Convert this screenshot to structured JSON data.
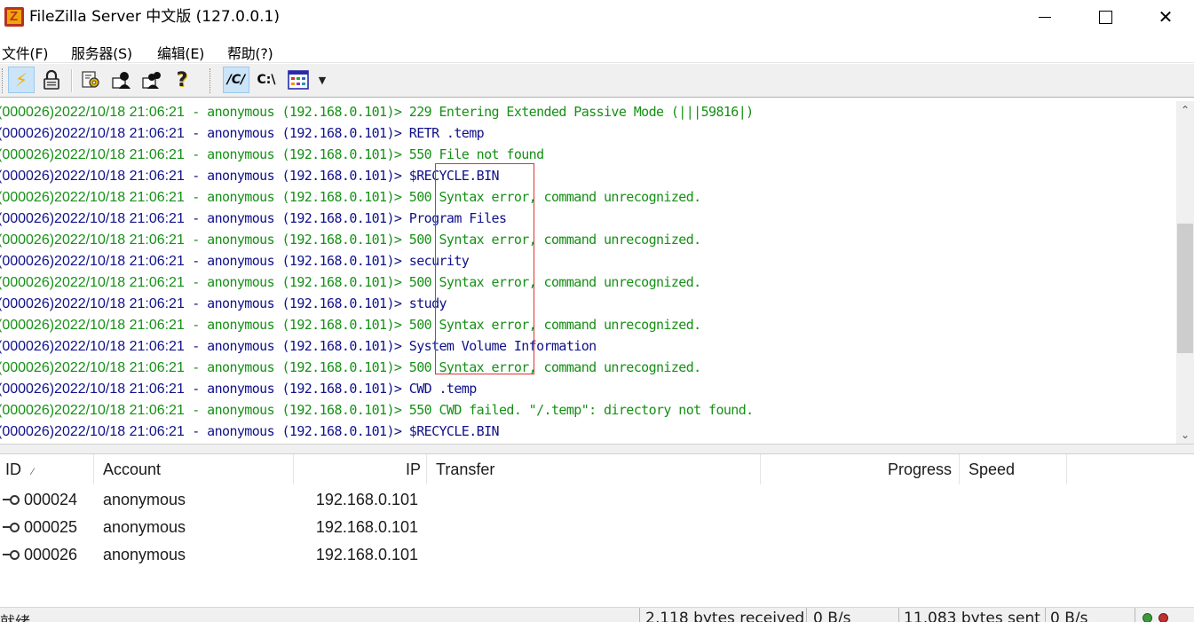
{
  "window": {
    "title": "FileZilla Server 中文版 (127.0.0.1)",
    "app_icon_letter": "Z",
    "minimize_label": "",
    "maximize_label": "",
    "close_label": "✕"
  },
  "menu": [
    {
      "label": "文件(F)"
    },
    {
      "label": "服务器(S)"
    },
    {
      "label": "编辑(E)"
    },
    {
      "label": "帮助(?)"
    }
  ],
  "toolbar": {
    "connect_glyph": "⚡",
    "lock_glyph": "🔒",
    "help_glyph": "?",
    "path_unix_label": "/C/",
    "path_win_label": "C:\\",
    "dropdown_glyph": "▼"
  },
  "log": {
    "lines": [
      {
        "type": "resp",
        "prefix": "(000026)",
        "ts": "2022/10/18 21:06:21",
        "text": " - anonymous (192.168.0.101)> 229 Entering Extended Passive Mode (|||59816|)"
      },
      {
        "type": "cmd",
        "prefix": "(000026)",
        "ts": "2022/10/18 21:06:21",
        "text": " - anonymous (192.168.0.101)> RETR .temp"
      },
      {
        "type": "resp",
        "prefix": "(000026)",
        "ts": "2022/10/18 21:06:21",
        "text": " - anonymous (192.168.0.101)> 550 File not found"
      },
      {
        "type": "cmd",
        "prefix": "(000026)",
        "ts": "2022/10/18 21:06:21",
        "text": " - anonymous (192.168.0.101)> $RECYCLE.BIN"
      },
      {
        "type": "resp",
        "prefix": "(000026)",
        "ts": "2022/10/18 21:06:21",
        "text": " - anonymous (192.168.0.101)> 500 Syntax error, command unrecognized."
      },
      {
        "type": "cmd",
        "prefix": "(000026)",
        "ts": "2022/10/18 21:06:21",
        "text": " - anonymous (192.168.0.101)> Program Files"
      },
      {
        "type": "resp",
        "prefix": "(000026)",
        "ts": "2022/10/18 21:06:21",
        "text": " - anonymous (192.168.0.101)> 500 Syntax error, command unrecognized."
      },
      {
        "type": "cmd",
        "prefix": "(000026)",
        "ts": "2022/10/18 21:06:21",
        "text": " - anonymous (192.168.0.101)> security"
      },
      {
        "type": "resp",
        "prefix": "(000026)",
        "ts": "2022/10/18 21:06:21",
        "text": " - anonymous (192.168.0.101)> 500 Syntax error, command unrecognized."
      },
      {
        "type": "cmd",
        "prefix": "(000026)",
        "ts": "2022/10/18 21:06:21",
        "text": " - anonymous (192.168.0.101)> study"
      },
      {
        "type": "resp",
        "prefix": "(000026)",
        "ts": "2022/10/18 21:06:21",
        "text": " - anonymous (192.168.0.101)> 500 Syntax error, command unrecognized."
      },
      {
        "type": "cmd",
        "prefix": "(000026)",
        "ts": "2022/10/18 21:06:21",
        "text": " - anonymous (192.168.0.101)> System Volume Information"
      },
      {
        "type": "resp",
        "prefix": "(000026)",
        "ts": "2022/10/18 21:06:21",
        "text": " - anonymous (192.168.0.101)> 500 Syntax error, command unrecognized."
      },
      {
        "type": "cmd",
        "prefix": "(000026)",
        "ts": "2022/10/18 21:06:21",
        "text": " - anonymous (192.168.0.101)> CWD .temp"
      },
      {
        "type": "resp",
        "prefix": "(000026)",
        "ts": "2022/10/18 21:06:21",
        "text": " - anonymous (192.168.0.101)> 550 CWD failed. \"/.temp\": directory not found."
      },
      {
        "type": "cmd",
        "prefix": "(000026)",
        "ts": "2022/10/18 21:06:21",
        "text": " - anonymous (192.168.0.101)> $RECYCLE.BIN"
      }
    ],
    "command_color": "#10108a",
    "response_color": "#159015"
  },
  "scrollbar": {
    "up_glyph": "⌃",
    "down_glyph": "⌄"
  },
  "sessions": {
    "columns": {
      "id": "ID",
      "id_sort": "⁄",
      "account": "Account",
      "ip": "IP",
      "transfer": "Transfer",
      "progress": "Progress",
      "speed": "Speed"
    },
    "rows": [
      {
        "id": "000024",
        "account": "anonymous",
        "ip": "192.168.0.101"
      },
      {
        "id": "000025",
        "account": "anonymous",
        "ip": "192.168.0.101"
      },
      {
        "id": "000026",
        "account": "anonymous",
        "ip": "192.168.0.101"
      }
    ]
  },
  "status": {
    "ready": "就绪",
    "received": "2,118 bytes received",
    "recv_rate": "0 B/s",
    "sent": "11,083 bytes sent",
    "sent_rate": "0 B/s"
  }
}
